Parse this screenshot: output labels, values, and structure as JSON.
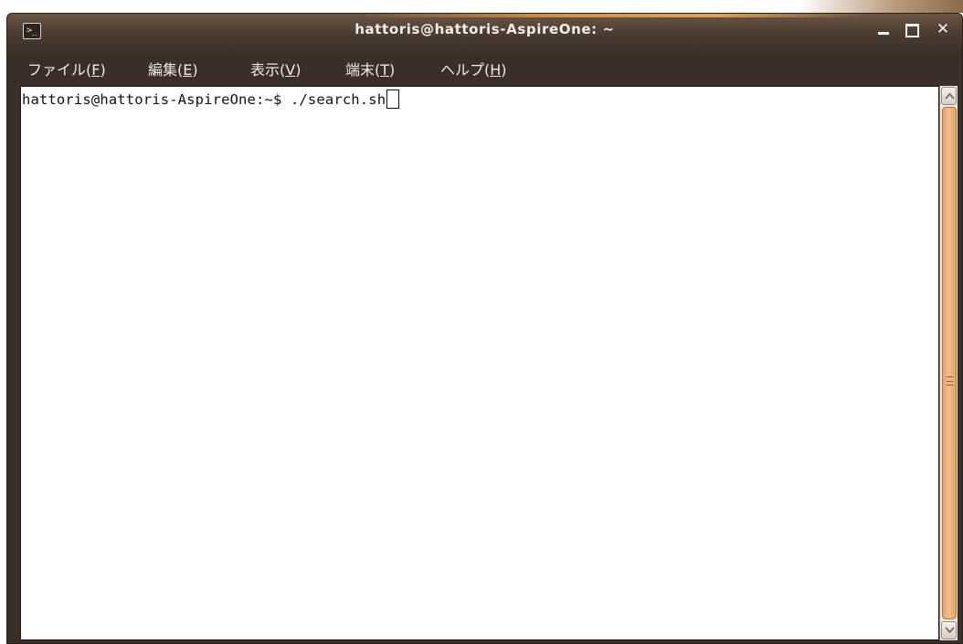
{
  "window": {
    "title": "hattoris@hattoris-AspireOne: ~",
    "icon": "terminal-icon",
    "controls": {
      "minimize": "minimize-icon",
      "maximize": "maximize-icon",
      "close": "✕"
    }
  },
  "menu": {
    "file": {
      "label": "ファイル(",
      "mnemonic": "F",
      "suffix": ")"
    },
    "edit": {
      "label": "編集(",
      "mnemonic": "E",
      "suffix": ")"
    },
    "view": {
      "label": "表示(",
      "mnemonic": "V",
      "suffix": ")"
    },
    "terminal": {
      "label": "端末(",
      "mnemonic": "T",
      "suffix": ")"
    },
    "help": {
      "label": "ヘルプ(",
      "mnemonic": "H",
      "suffix": ")"
    }
  },
  "terminal": {
    "prompt": "hattoris@hattoris-AspireOne:~$ ",
    "command": "./search.sh"
  },
  "colors": {
    "titlebar": "#4c3d32",
    "accent": "#e8a56a",
    "terminal_bg": "#ffffff",
    "terminal_fg": "#111111"
  }
}
